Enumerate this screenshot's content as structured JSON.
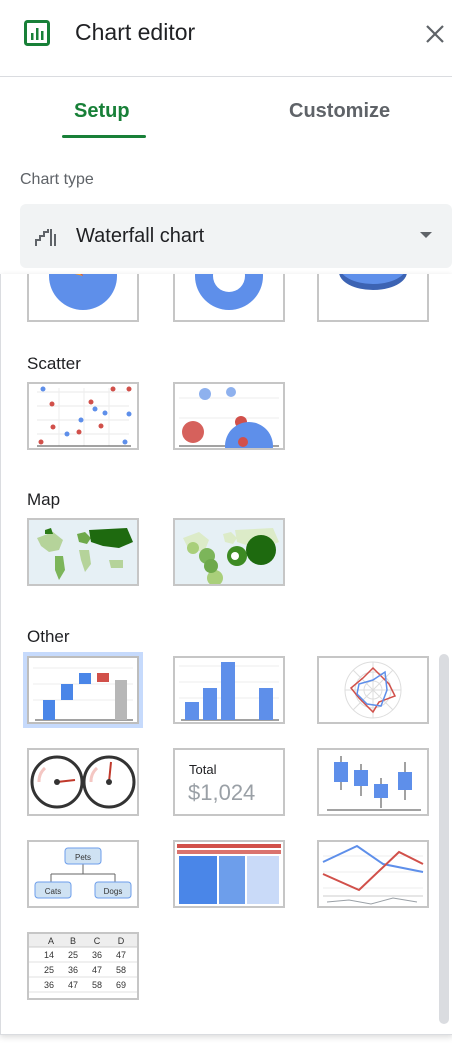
{
  "header": {
    "title": "Chart editor",
    "app_icon": "chart-icon",
    "close_icon": "close-icon"
  },
  "tabs": [
    {
      "label": "Setup",
      "active": true
    },
    {
      "label": "Customize",
      "active": false
    }
  ],
  "chart_type": {
    "label": "Chart type",
    "selected": "Waterfall chart",
    "icon": "waterfall-icon"
  },
  "groups": {
    "scatter": "Scatter",
    "map": "Map",
    "other": "Other"
  },
  "thumbs": {
    "scorecard_label": "Total",
    "scorecard_value": "$1,024",
    "org_root": "Pets",
    "org_left": "Cats",
    "org_right": "Dogs",
    "table_headers": [
      "A",
      "B",
      "C",
      "D"
    ],
    "table_rows": [
      [
        "14",
        "25",
        "36",
        "47"
      ],
      [
        "25",
        "36",
        "47",
        "58"
      ],
      [
        "36",
        "47",
        "58",
        "69"
      ]
    ]
  },
  "colors": {
    "accent": "#188038",
    "blue": "#5e8fea",
    "red": "#d1504a",
    "green": "#3d8b23"
  }
}
